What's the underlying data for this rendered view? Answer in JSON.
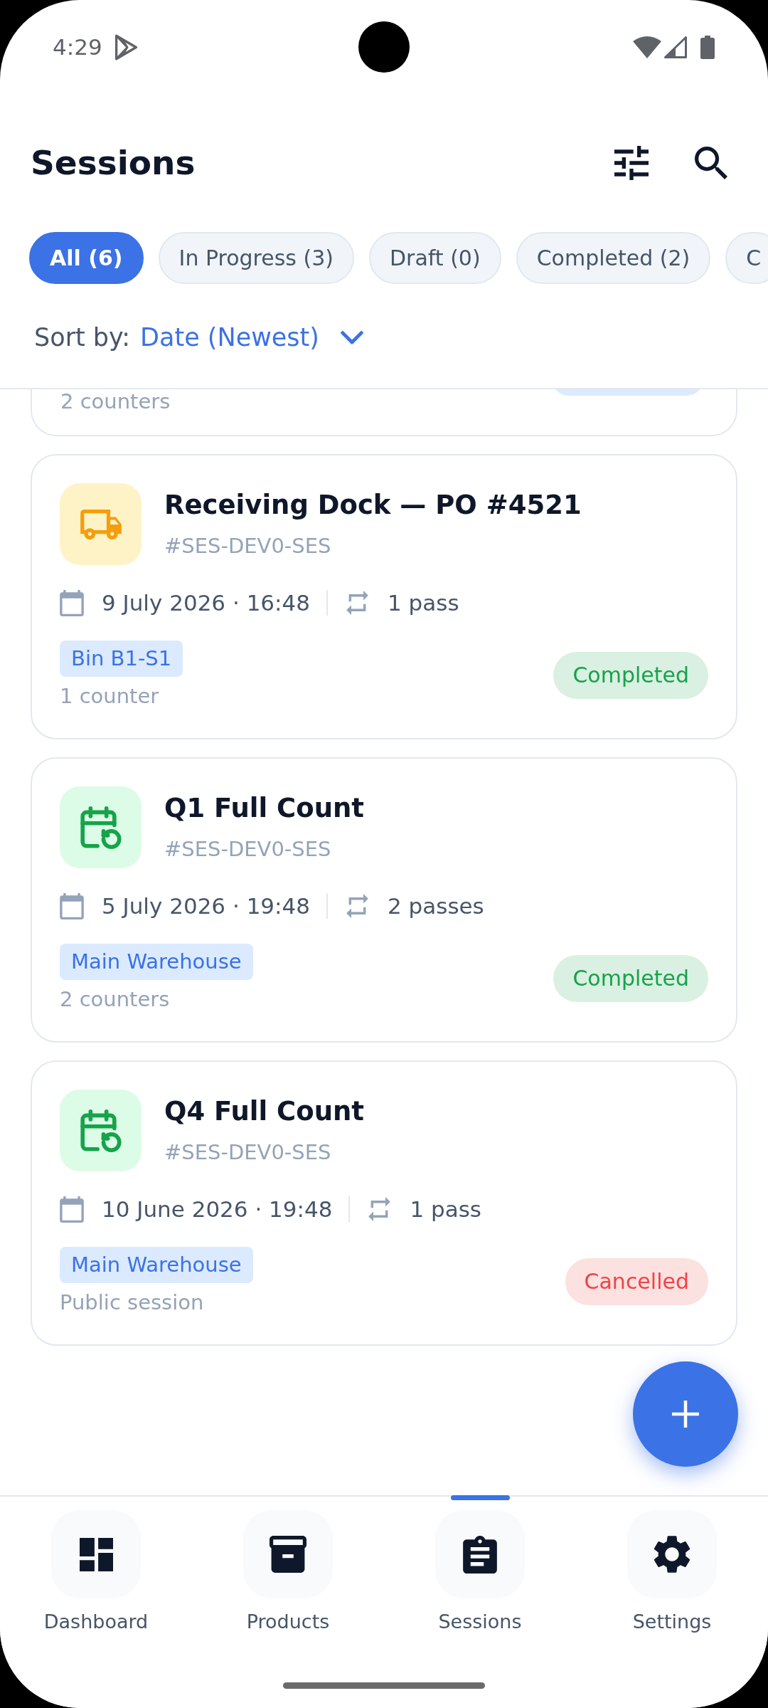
{
  "status_bar": {
    "time": "4:29"
  },
  "header": {
    "title": "Sessions"
  },
  "filters": [
    {
      "label": "All (6)",
      "selected": true
    },
    {
      "label": "In Progress (3)",
      "selected": false
    },
    {
      "label": "Draft (0)",
      "selected": false
    },
    {
      "label": "Completed (2)",
      "selected": false
    },
    {
      "label": "C",
      "selected": false
    }
  ],
  "sort": {
    "label": "Sort by:",
    "value": "Date (Newest)"
  },
  "sessions": [
    {
      "kind": "clipped",
      "note": "2 counters",
      "status": {
        "color": "#dbeafe"
      }
    },
    {
      "kind": "receiving",
      "title": "Receiving Dock — PO #4521",
      "code": "#SES-DEV0-SES",
      "date": "9 July 2026 · 16:48",
      "passes": "1 pass",
      "location": "Bin B1-S1",
      "note": "1 counter",
      "status": {
        "label": "Completed",
        "color": "#16a34a"
      }
    },
    {
      "kind": "full_count",
      "title": "Q1 Full Count",
      "code": "#SES-DEV0-SES",
      "date": "5 July 2026 · 19:48",
      "passes": "2 passes",
      "location": "Main Warehouse",
      "note": "2 counters",
      "status": {
        "label": "Completed",
        "color": "#16a34a"
      }
    },
    {
      "kind": "full_count",
      "title": "Q4 Full Count",
      "code": "#SES-DEV0-SES",
      "date": "10 June 2026 · 19:48",
      "passes": "1 pass",
      "location": "Main Warehouse",
      "note": "Public session",
      "status": {
        "label": "Cancelled",
        "color": "#ef4444"
      }
    }
  ],
  "nav": [
    {
      "label": "Dashboard",
      "selected": false
    },
    {
      "label": "Products",
      "selected": false
    },
    {
      "label": "Sessions",
      "selected": true
    },
    {
      "label": "Settings",
      "selected": false
    }
  ]
}
